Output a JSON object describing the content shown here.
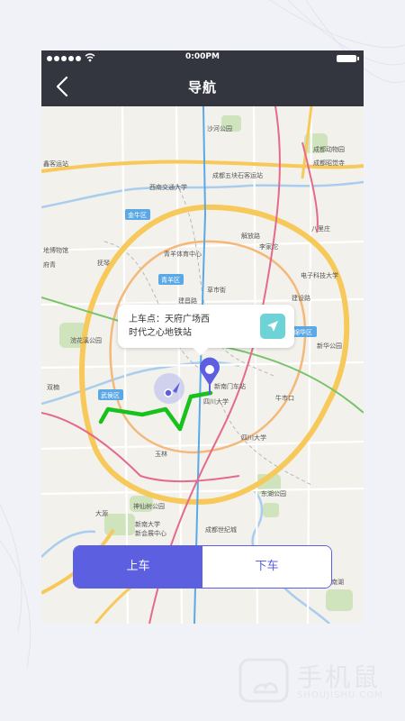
{
  "status_bar": {
    "time": "0:00PM"
  },
  "nav": {
    "title": "导航"
  },
  "map": {
    "labels": [
      {
        "text": "沙河公园"
      },
      {
        "text": "成都动物园"
      },
      {
        "text": "成都昭觉寺"
      },
      {
        "text": "鑫客运站"
      },
      {
        "text": "西南交通大学"
      },
      {
        "text": "成都五块石客运站"
      },
      {
        "text": "金牛区"
      },
      {
        "text": "八里庄"
      },
      {
        "text": "解放路"
      },
      {
        "text": "李家沱"
      },
      {
        "text": "青羊体育中心"
      },
      {
        "text": "电子科技大学"
      },
      {
        "text": "地博物馆"
      },
      {
        "text": "抚琴"
      },
      {
        "text": "府青"
      },
      {
        "text": "青羊区"
      },
      {
        "text": "草市街"
      },
      {
        "text": "建设路"
      },
      {
        "text": "建昌路"
      },
      {
        "text": "锦华区"
      },
      {
        "text": "新华公园"
      },
      {
        "text": "浣花溪公园"
      },
      {
        "text": "新南门车站"
      },
      {
        "text": "牛市口"
      },
      {
        "text": "双楠"
      },
      {
        "text": "武侯区"
      },
      {
        "text": "四川大学"
      },
      {
        "text": "四川大学"
      },
      {
        "text": "玉林"
      },
      {
        "text": "东湖公园"
      },
      {
        "text": "神仙树公园"
      },
      {
        "text": "新南大学"
      },
      {
        "text": "新会展中心"
      },
      {
        "text": "大源"
      },
      {
        "text": "成都世纪城"
      },
      {
        "text": "南湖"
      }
    ]
  },
  "popup": {
    "prefix": "上车点：",
    "line1": "天府广场西",
    "line2": "时代之心地铁站",
    "nav_icon": "navigation-arrow-icon"
  },
  "segmented": {
    "board": "上车",
    "alight": "下车",
    "board_color": "#5b5fe0",
    "alight_color": "#ffffff"
  },
  "watermark": {
    "text": "手机鼠",
    "sub": "SHOUJISHU.COM"
  },
  "colors": {
    "route": "#19c11d",
    "ring_road": "#f7c95a",
    "metro_blue": "#5aa9e6",
    "metro_red": "#e46a8b",
    "pin": "#5b5fe0",
    "nav_bar": "#34363f"
  }
}
